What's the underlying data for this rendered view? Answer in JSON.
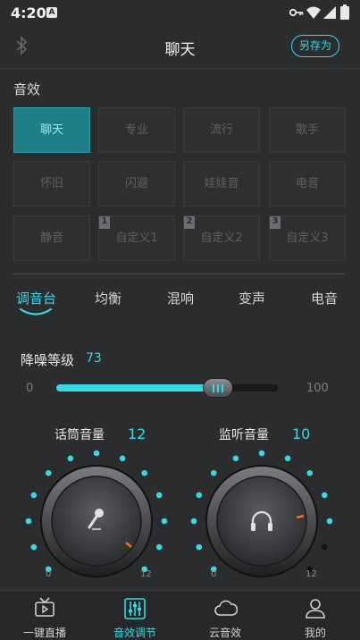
{
  "status_bar": {
    "time": "4:20",
    "notification": "A"
  },
  "header": {
    "title": "聊天",
    "save_as": "另存为"
  },
  "section_title": "音效",
  "presets": [
    {
      "label": "聊天",
      "active": true
    },
    {
      "label": "专业"
    },
    {
      "label": "流行"
    },
    {
      "label": "歌手"
    },
    {
      "label": "怀旧"
    },
    {
      "label": "闪避"
    },
    {
      "label": "娃娃音"
    },
    {
      "label": "电音"
    },
    {
      "label": "静音"
    },
    {
      "label": "自定义1",
      "badge": "1"
    },
    {
      "label": "自定义2",
      "badge": "2"
    },
    {
      "label": "自定义3",
      "badge": "3"
    }
  ],
  "tabs": [
    "调音台",
    "均衡",
    "混响",
    "变声",
    "电音"
  ],
  "noise": {
    "label": "降噪等级",
    "value": "73",
    "min": "0",
    "max": "100",
    "level": 0.73
  },
  "mic": {
    "label": "话筒音量",
    "value": "12",
    "min": "0",
    "max": "12",
    "icon": "microphone-icon"
  },
  "monitor": {
    "label": "监听音量",
    "value": "10",
    "min": "0",
    "max": "12",
    "icon": "headphones-icon"
  },
  "nav": [
    {
      "label": "一键直播",
      "icon": "tv-icon"
    },
    {
      "label": "音效调节",
      "icon": "equalizer-icon",
      "active": true
    },
    {
      "label": "云音效",
      "icon": "cloud-icon"
    },
    {
      "label": "我的",
      "icon": "person-icon"
    }
  ],
  "colors": {
    "accent": "#36d8e6",
    "background": "#2b2c2e",
    "preset_active": "#1e7f88",
    "knob_marker": "#ff6a1a"
  }
}
